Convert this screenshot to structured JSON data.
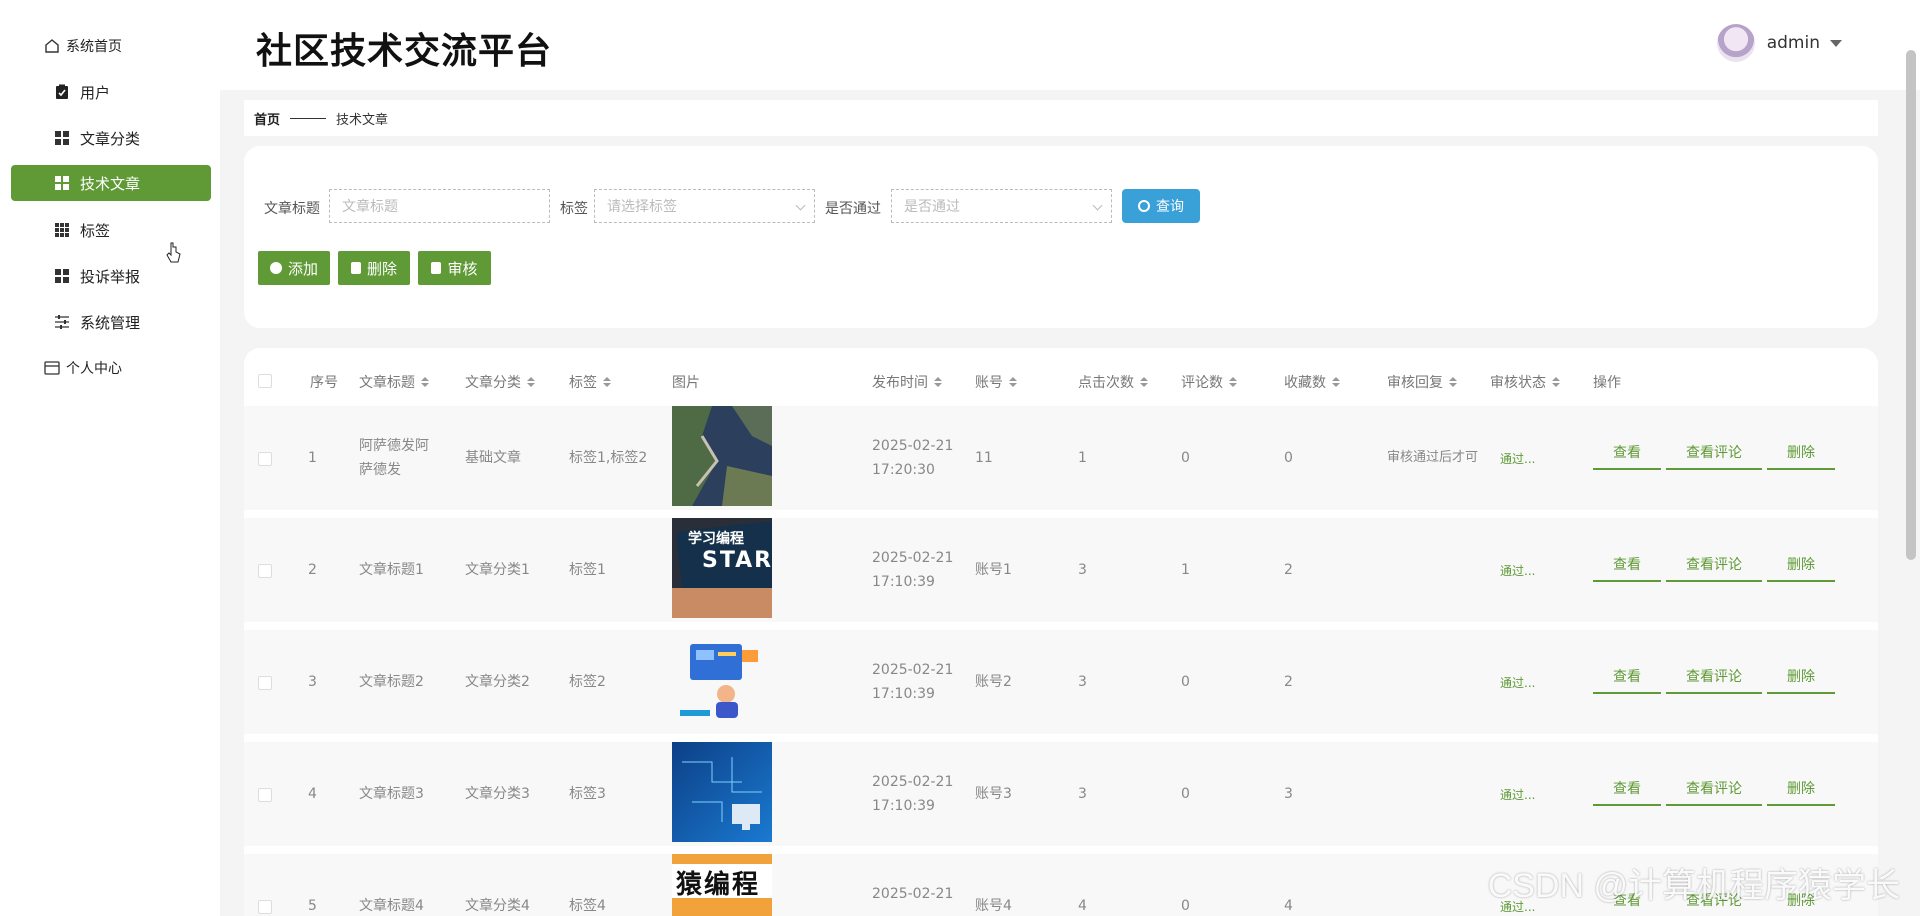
{
  "app": {
    "title": "社区技术交流平台"
  },
  "user": {
    "name": "admin"
  },
  "sidebar": {
    "items": [
      {
        "label": "系统首页",
        "icon": "home-icon"
      },
      {
        "label": "用户",
        "icon": "clipboard-icon"
      },
      {
        "label": "文章分类",
        "icon": "grid-icon"
      },
      {
        "label": "技术文章",
        "icon": "grid-icon",
        "active": true
      },
      {
        "label": "标签",
        "icon": "grid9-icon"
      },
      {
        "label": "投诉举报",
        "icon": "grid-icon"
      },
      {
        "label": "系统管理",
        "icon": "sliders-icon"
      },
      {
        "label": "个人中心",
        "icon": "card-icon"
      }
    ]
  },
  "breadcrumb": {
    "home": "首页",
    "current": "技术文章"
  },
  "search": {
    "title_label": "文章标题",
    "title_placeholder": "文章标题",
    "tag_label": "标签",
    "tag_placeholder": "请选择标签",
    "pass_label": "是否通过",
    "pass_placeholder": "是否通过",
    "query_button": "查询"
  },
  "actions": {
    "add": "添加",
    "delete": "删除",
    "review": "审核"
  },
  "table": {
    "columns": [
      "序号",
      "文章标题",
      "文章分类",
      "标签",
      "图片",
      "发布时间",
      "账号",
      "点击次数",
      "评论数",
      "收藏数",
      "审核回复",
      "审核状态",
      "操作"
    ],
    "ops": {
      "view": "查看",
      "view_comments": "查看评论",
      "delete": "删除"
    },
    "rows": [
      {
        "no": "1",
        "title": "阿萨德发阿萨德发",
        "category": "基础文章",
        "tags": "标签1,标签2",
        "date": "2025-02-21",
        "time": "17:20:30",
        "account": "11",
        "clicks": "1",
        "comments": "0",
        "favorites": "0",
        "reply": "审核通过后才可",
        "status": "通过..."
      },
      {
        "no": "2",
        "title": "文章标题1",
        "category": "文章分类1",
        "tags": "标签1",
        "date": "2025-02-21",
        "time": "17:10:39",
        "account": "账号1",
        "clicks": "3",
        "comments": "1",
        "favorites": "2",
        "reply": "",
        "status": "通过...",
        "image_text_1": "学习编程",
        "image_text_2": "START"
      },
      {
        "no": "3",
        "title": "文章标题2",
        "category": "文章分类2",
        "tags": "标签2",
        "date": "2025-02-21",
        "time": "17:10:39",
        "account": "账号2",
        "clicks": "3",
        "comments": "0",
        "favorites": "2",
        "reply": "",
        "status": "通过..."
      },
      {
        "no": "4",
        "title": "文章标题3",
        "category": "文章分类3",
        "tags": "标签3",
        "date": "2025-02-21",
        "time": "17:10:39",
        "account": "账号3",
        "clicks": "3",
        "comments": "0",
        "favorites": "3",
        "reply": "",
        "status": "通过..."
      },
      {
        "no": "5",
        "title": "文章标题4",
        "category": "文章分类4",
        "tags": "标签4",
        "date": "2025-02-21",
        "time": "",
        "account": "账号4",
        "clicks": "4",
        "comments": "0",
        "favorites": "4",
        "reply": "",
        "status": "通过...",
        "image_text_1": "猿编程"
      }
    ]
  },
  "watermark": "CSDN @计算机程序猿学长",
  "colors": {
    "primary": "#5f9a36",
    "query": "#3aa0d8"
  }
}
